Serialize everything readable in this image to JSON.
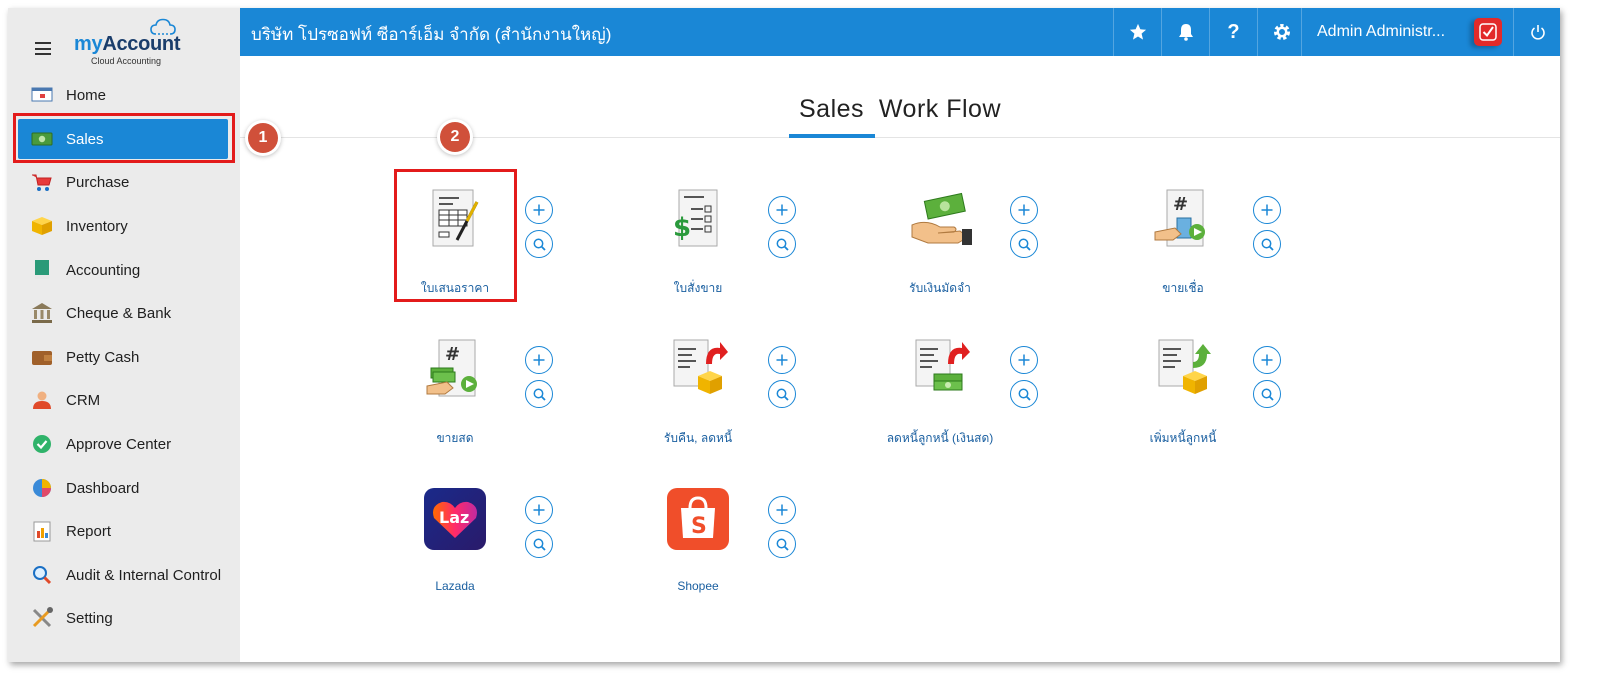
{
  "app": {
    "logo_my": "my",
    "logo_account": "Account",
    "logo_subtitle": "Cloud Accounting"
  },
  "topbar": {
    "company": "บริษัท โปรซอฟท์ ซีอาร์เอ็ม จำกัด (สำนักงานใหญ่)",
    "user_name": "Admin Administr...",
    "icons": [
      "star-icon",
      "bell-icon",
      "help-icon",
      "gear-icon",
      "power-icon"
    ]
  },
  "sidebar": {
    "items": [
      {
        "label": "Home",
        "icon": "home-icon"
      },
      {
        "label": "Sales",
        "icon": "money-icon",
        "active": true
      },
      {
        "label": "Purchase",
        "icon": "cart-icon"
      },
      {
        "label": "Inventory",
        "icon": "box-icon"
      },
      {
        "label": "Accounting",
        "icon": "book-icon"
      },
      {
        "label": "Cheque & Bank",
        "icon": "bank-icon"
      },
      {
        "label": "Petty Cash",
        "icon": "wallet-icon"
      },
      {
        "label": "CRM",
        "icon": "people-icon"
      },
      {
        "label": "Approve Center",
        "icon": "check-circle-icon"
      },
      {
        "label": "Dashboard",
        "icon": "pie-chart-icon"
      },
      {
        "label": "Report",
        "icon": "report-icon"
      },
      {
        "label": "Audit & Internal Control",
        "icon": "magnifier-icon"
      },
      {
        "label": "Setting",
        "icon": "tools-icon"
      }
    ]
  },
  "annotations": {
    "step1": "1",
    "step2": "2"
  },
  "main": {
    "title": "Sales  Work Flow",
    "tiles": [
      {
        "label": "ใบเสนอราคา",
        "icon": "quotation-icon"
      },
      {
        "label": "ใบสั่งขาย",
        "icon": "sales-order-icon"
      },
      {
        "label": "รับเงินมัดจำ",
        "icon": "deposit-icon"
      },
      {
        "label": "ขายเชื่อ",
        "icon": "credit-sale-icon"
      },
      {
        "label": "ขายสด",
        "icon": "cash-sale-icon"
      },
      {
        "label": "รับคืน, ลดหนี้",
        "icon": "return-credit-icon"
      },
      {
        "label": "ลดหนี้ลูกหนี้ (เงินสด)",
        "icon": "cash-credit-note-icon"
      },
      {
        "label": "เพิ่มหนี้ลูกหนี้",
        "icon": "debit-note-icon"
      },
      {
        "label": "Lazada",
        "icon": "lazada-icon"
      },
      {
        "label": "Shopee",
        "icon": "shopee-icon"
      }
    ]
  },
  "colors": {
    "primary": "#1a87d6",
    "highlight": "#e31b1b",
    "badge": "#d0503a"
  }
}
